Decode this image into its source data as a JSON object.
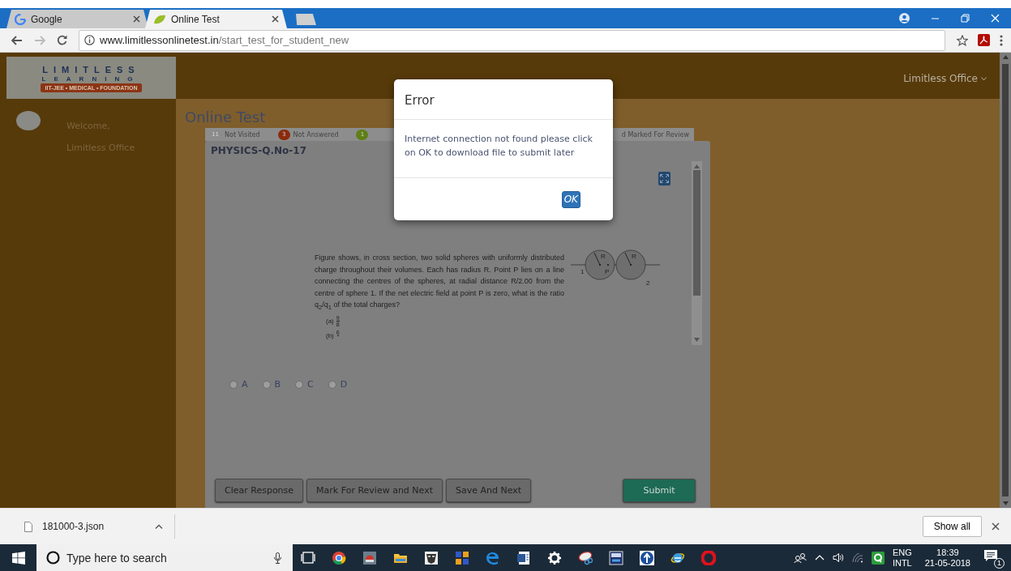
{
  "browser": {
    "tabs": [
      {
        "title": "Google",
        "selected": false
      },
      {
        "title": "Online Test",
        "selected": true
      }
    ],
    "url_host": "www.limitlessonlinetest.in",
    "url_path": "/start_test_for_student_new"
  },
  "site": {
    "logo": {
      "word": "LIMITLESS",
      "subword": "LEARNING",
      "tagline": "IIT-JEE • MEDICAL • FOUNDATION"
    },
    "user_menu": "Limitless Office",
    "sidebar": {
      "greeting": "Welcome,",
      "user": "Limitless Office"
    },
    "page_title": "Online Test",
    "legend": [
      {
        "count": "11",
        "label": "Not Visited",
        "color": "#8c8c8c"
      },
      {
        "count": "3",
        "label": "Not Answered",
        "color": "#8a2b0e"
      },
      {
        "count": "1",
        "color": "#5f7f17"
      }
    ],
    "legend_tail": "d Marked For Review",
    "question": {
      "title": "PHYSICS-Q.No-17",
      "text": "Figure shows, in cross section, two solid spheres with uniformly distributed charge throughout their volumes. Each has radius R. Point P lies on a line connecting the centres of the spheres, at radial distance R/2.00 from the centre of sphere 1. If the net electric field at point P is zero, what is the ratio q$_{2}$/q$_{1}$ of the total charges?",
      "choices": [
        {
          "label": "(a)",
          "numerator": "9",
          "denominator": "8"
        },
        {
          "label": "(b)",
          "numerator": "6"
        }
      ],
      "diagram_labels": [
        "R",
        "R",
        "1",
        "P",
        "2"
      ],
      "options": [
        {
          "label": "A",
          "selected": false
        },
        {
          "label": "B",
          "selected": false
        },
        {
          "label": "C",
          "selected": false
        },
        {
          "label": "D",
          "selected": false
        }
      ],
      "buttons": [
        {
          "label": "Clear Response",
          "kind": "secondary"
        },
        {
          "label": "Mark For Review and Next",
          "kind": "secondary"
        },
        {
          "label": "Save And Next",
          "kind": "secondary"
        },
        {
          "label": "Submit",
          "kind": "primary"
        }
      ]
    }
  },
  "dialog": {
    "title": "Error",
    "message": "Internet connection not found please click on OK to download file to submit later",
    "button": "OK"
  },
  "downloads": {
    "file": "181000-3.json",
    "show_all": "Show all"
  },
  "taskbar": {
    "search_placeholder": "Type here to search",
    "language": "ENG",
    "layout": "INTL",
    "time": "18:39",
    "date": "21-05-2018",
    "notifications": "1"
  }
}
